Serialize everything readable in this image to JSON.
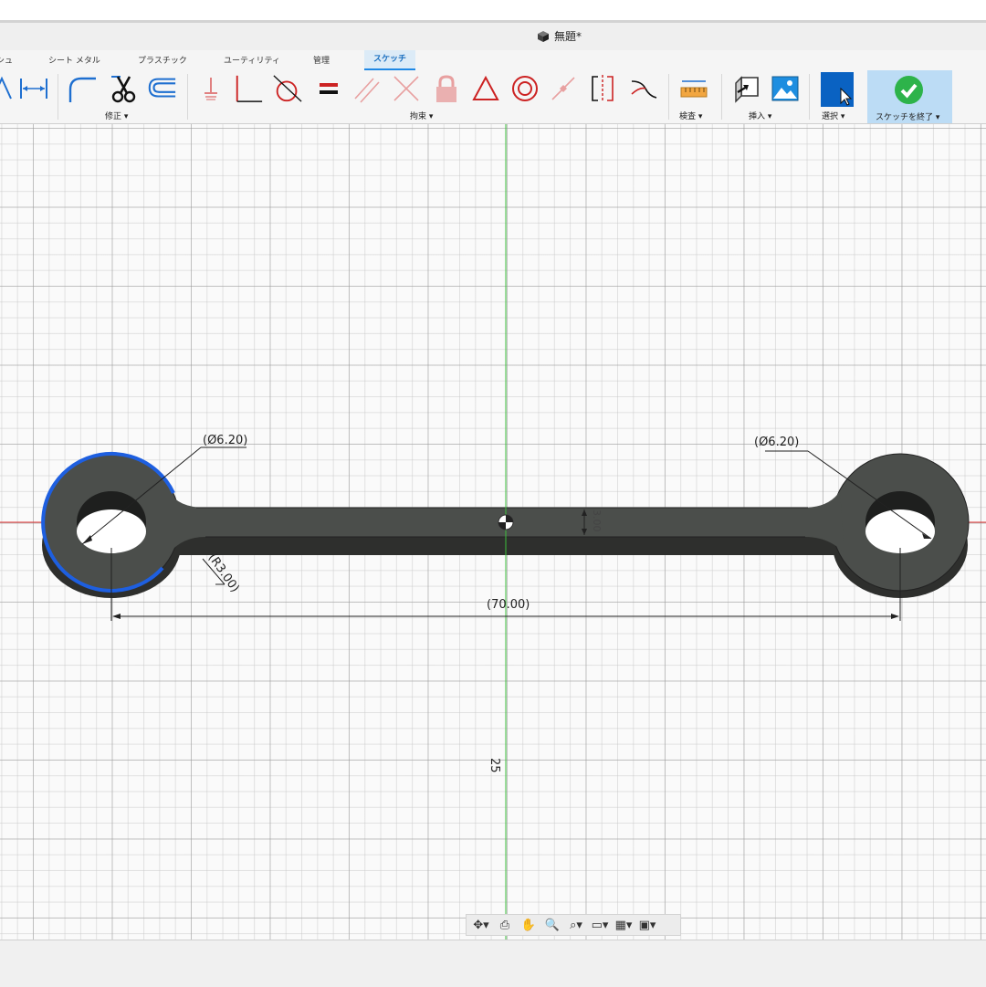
{
  "window": {
    "title": "無題*"
  },
  "tabs": [
    {
      "label": "シュ"
    },
    {
      "label": "シート メタル"
    },
    {
      "label": "プラスチック"
    },
    {
      "label": "ユーティリティ"
    },
    {
      "label": "管理"
    },
    {
      "label": "スケッチ",
      "active": true
    }
  ],
  "ribbon": {
    "groups": {
      "modify": "修正 ▾",
      "constraints": "拘束 ▾",
      "inspect": "検査 ▾",
      "insert": "挿入 ▾",
      "select": "選択 ▾",
      "finish": "スケッチを終了 ▾"
    },
    "icons": [
      "dimension-icon",
      "horizontal-dimension-icon",
      "fillet-icon",
      "trim-icon",
      "offset-icon",
      "fix-icon",
      "perpendicular-icon",
      "tangent-icon",
      "equal-icon",
      "parallel-icon",
      "perpendicular-constraint-icon",
      "lock-icon",
      "triangle-icon",
      "concentric-icon",
      "midpoint-icon",
      "symmetry-icon",
      "curvature-icon",
      "measure-icon",
      "insert-icon",
      "image-icon",
      "select-icon",
      "checkmark-icon"
    ],
    "colors": {
      "finish_bg": "#bcdcf5",
      "check_green": "#2db34a",
      "constraint_red": "#cc2222"
    }
  },
  "sketch": {
    "dimensions": {
      "left_diameter": "(Ø6.20)",
      "right_diameter": "(Ø6.20)",
      "radius": "(R3.00)",
      "length": "(70.00)",
      "thickness": "3.00",
      "vertical_value": "25"
    },
    "colors": {
      "x_axis": "#e03030",
      "y_axis": "#3cbf3c",
      "body": "#4b4e4b",
      "highlight": "#1e5fe0"
    }
  },
  "navbar": {
    "icons": [
      "orbit-icon",
      "look-at-icon",
      "pan-icon",
      "zoom-icon",
      "fit-icon",
      "display-icon",
      "grid-icon",
      "viewports-icon"
    ]
  }
}
